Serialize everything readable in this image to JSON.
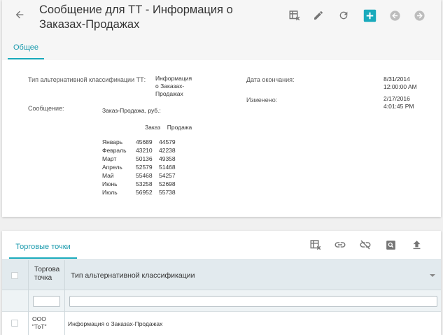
{
  "header": {
    "title": "Сообщение для ТТ - Информация о Заказах-Продажах",
    "toolbar": [
      "table-clear-icon",
      "edit-icon",
      "refresh-icon",
      "add-icon",
      "previous-icon",
      "next-icon"
    ]
  },
  "tabs": [
    {
      "label": "Общее",
      "active": true
    }
  ],
  "fields": {
    "alt_class_label": "Тип альтернативной классификации ТТ:",
    "alt_class_value": [
      "Информация",
      "о Заказах-",
      "Продажах"
    ],
    "message_label": "Сообщение:",
    "end_date_label": "Дата окончания:",
    "end_date_value": [
      "8/31/2014",
      "12:00:00 AM"
    ],
    "modified_label": "Изменено:",
    "modified_value": [
      "2/17/2016",
      "4:01:45 PM"
    ]
  },
  "message": {
    "heading": "Заказ-Продажа, руб.:",
    "col_order": "Заказ",
    "col_sale": "Продажа",
    "rows": [
      [
        "Январь",
        "45689",
        "44579"
      ],
      [
        "Февраль",
        "43210",
        "42238"
      ],
      [
        "Март",
        "50136",
        "49358"
      ],
      [
        "Апрель",
        "52579",
        "51468"
      ],
      [
        "Май",
        "55468",
        "54257"
      ],
      [
        "Июнь",
        "53258",
        "52698"
      ],
      [
        "Июль",
        "56952",
        "55738"
      ]
    ]
  },
  "section2": {
    "tab_label": "Торговые точки",
    "toolbar": [
      "table-clear-icon",
      "link-icon",
      "unlink-icon",
      "search-doc-icon",
      "upload-icon"
    ],
    "grid": {
      "col1": [
        "Торгова",
        "точка"
      ],
      "col2": "Тип альтернативной классификации",
      "rows": [
        {
          "outlet": [
            "ООО",
            "\"ТоТ\""
          ],
          "class_type": "Информация о Заказах-Продажах"
        }
      ]
    }
  },
  "colors": {
    "accent": "#1aaabc",
    "icon": "#757575",
    "icon_light": "#bdbdbd"
  }
}
